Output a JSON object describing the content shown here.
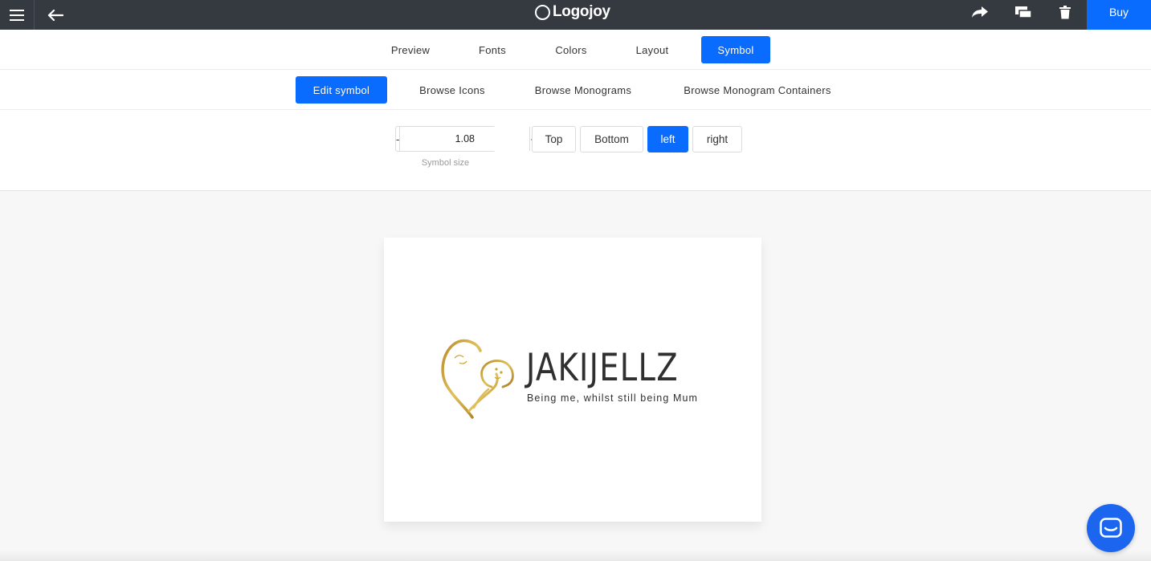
{
  "app": {
    "brand": "Logojoy",
    "buy_label": "Buy"
  },
  "tabs": [
    {
      "label": "Preview",
      "active": false
    },
    {
      "label": "Fonts",
      "active": false
    },
    {
      "label": "Colors",
      "active": false
    },
    {
      "label": "Layout",
      "active": false
    },
    {
      "label": "Symbol",
      "active": true
    }
  ],
  "subtabs": [
    {
      "label": "Edit symbol",
      "active": true
    },
    {
      "label": "Browse Icons",
      "active": false
    },
    {
      "label": "Browse Monograms",
      "active": false
    },
    {
      "label": "Browse Monogram Containers",
      "active": false
    }
  ],
  "symbol_size": {
    "minus": "-",
    "value": "1.08",
    "plus": "+",
    "label": "Symbol size"
  },
  "position_options": [
    {
      "label": "Top",
      "active": false
    },
    {
      "label": "Bottom",
      "active": false
    },
    {
      "label": "left",
      "active": true
    },
    {
      "label": "right",
      "active": false
    }
  ],
  "logo": {
    "name": "JAKIJELLZ",
    "tagline": "Being me, whilst still being Mum",
    "symbol": "heart-mother-baby-icon",
    "symbol_color": "#c9a227",
    "text_color": "#2f2f2f"
  },
  "icons": {
    "menu": "menu-icon",
    "back": "back-arrow-icon",
    "share": "share-icon",
    "compare": "compare-icon",
    "delete": "trash-icon",
    "chat": "chat-icon"
  },
  "colors": {
    "accent": "#0a6cff",
    "topbar": "#343a40"
  }
}
